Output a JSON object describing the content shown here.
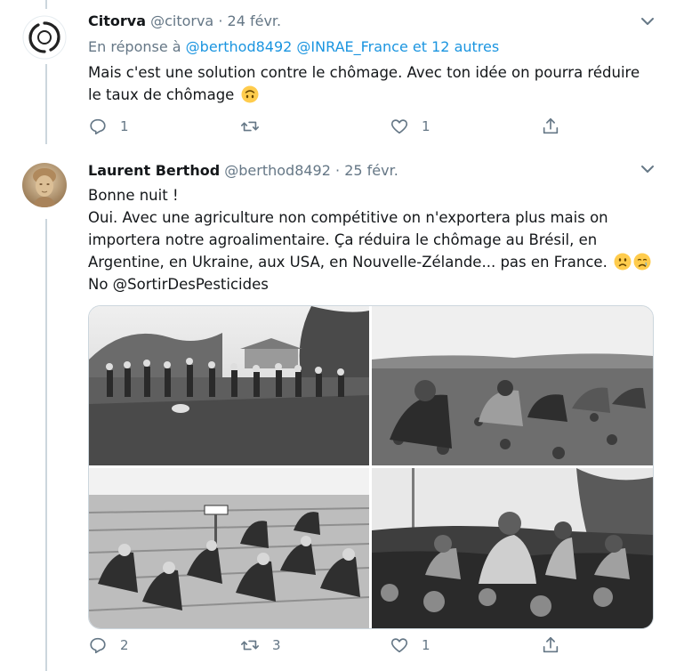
{
  "tweet1": {
    "name": "Citorva",
    "handle": "@citorva",
    "separator": "·",
    "date": "24 févr.",
    "reply_prefix": "En réponse à",
    "reply_mentions": [
      "@berthod8492",
      "@INRAE_France"
    ],
    "reply_suffix": "et 12 autres",
    "text_lines": [
      "Mais c'est une solution contre le chômage. Avec ton idée on pourra réduire",
      "le taux de chômage"
    ],
    "emoji": "upside-down-face",
    "actions": {
      "replies": "1",
      "retweets": "",
      "likes": "1"
    }
  },
  "tweet2": {
    "name": "Laurent Berthod",
    "handle": "@berthod8492",
    "separator": "·",
    "date": "25 févr.",
    "text_lines": [
      "Bonne nuit !",
      "Oui. Avec une agriculture non compétitive on n'exportera plus mais on",
      "importera notre agroalimentaire. Ça réduira le chômage au Brésil, en",
      "Argentine, en Ukraine, aux USA, en Nouvelle-Zélande... pas en France.",
      "No @SortirDesPesticides"
    ],
    "emojis": [
      "sad-face",
      "crying-face"
    ],
    "media": [
      "field-workers-hoeing-photo",
      "women-weeding-field-photo",
      "children-weeding-rows-photo",
      "girls-harvesting-photo"
    ],
    "actions": {
      "replies": "2",
      "retweets": "3",
      "likes": "1"
    }
  },
  "icons": [
    "reply-icon",
    "retweet-icon",
    "like-icon",
    "share-icon",
    "chevron-down-icon"
  ],
  "colors": {
    "link": "#1b95e0",
    "muted": "#657786",
    "thread_line": "#ccd6dd",
    "divider": "#e6ecf0"
  }
}
